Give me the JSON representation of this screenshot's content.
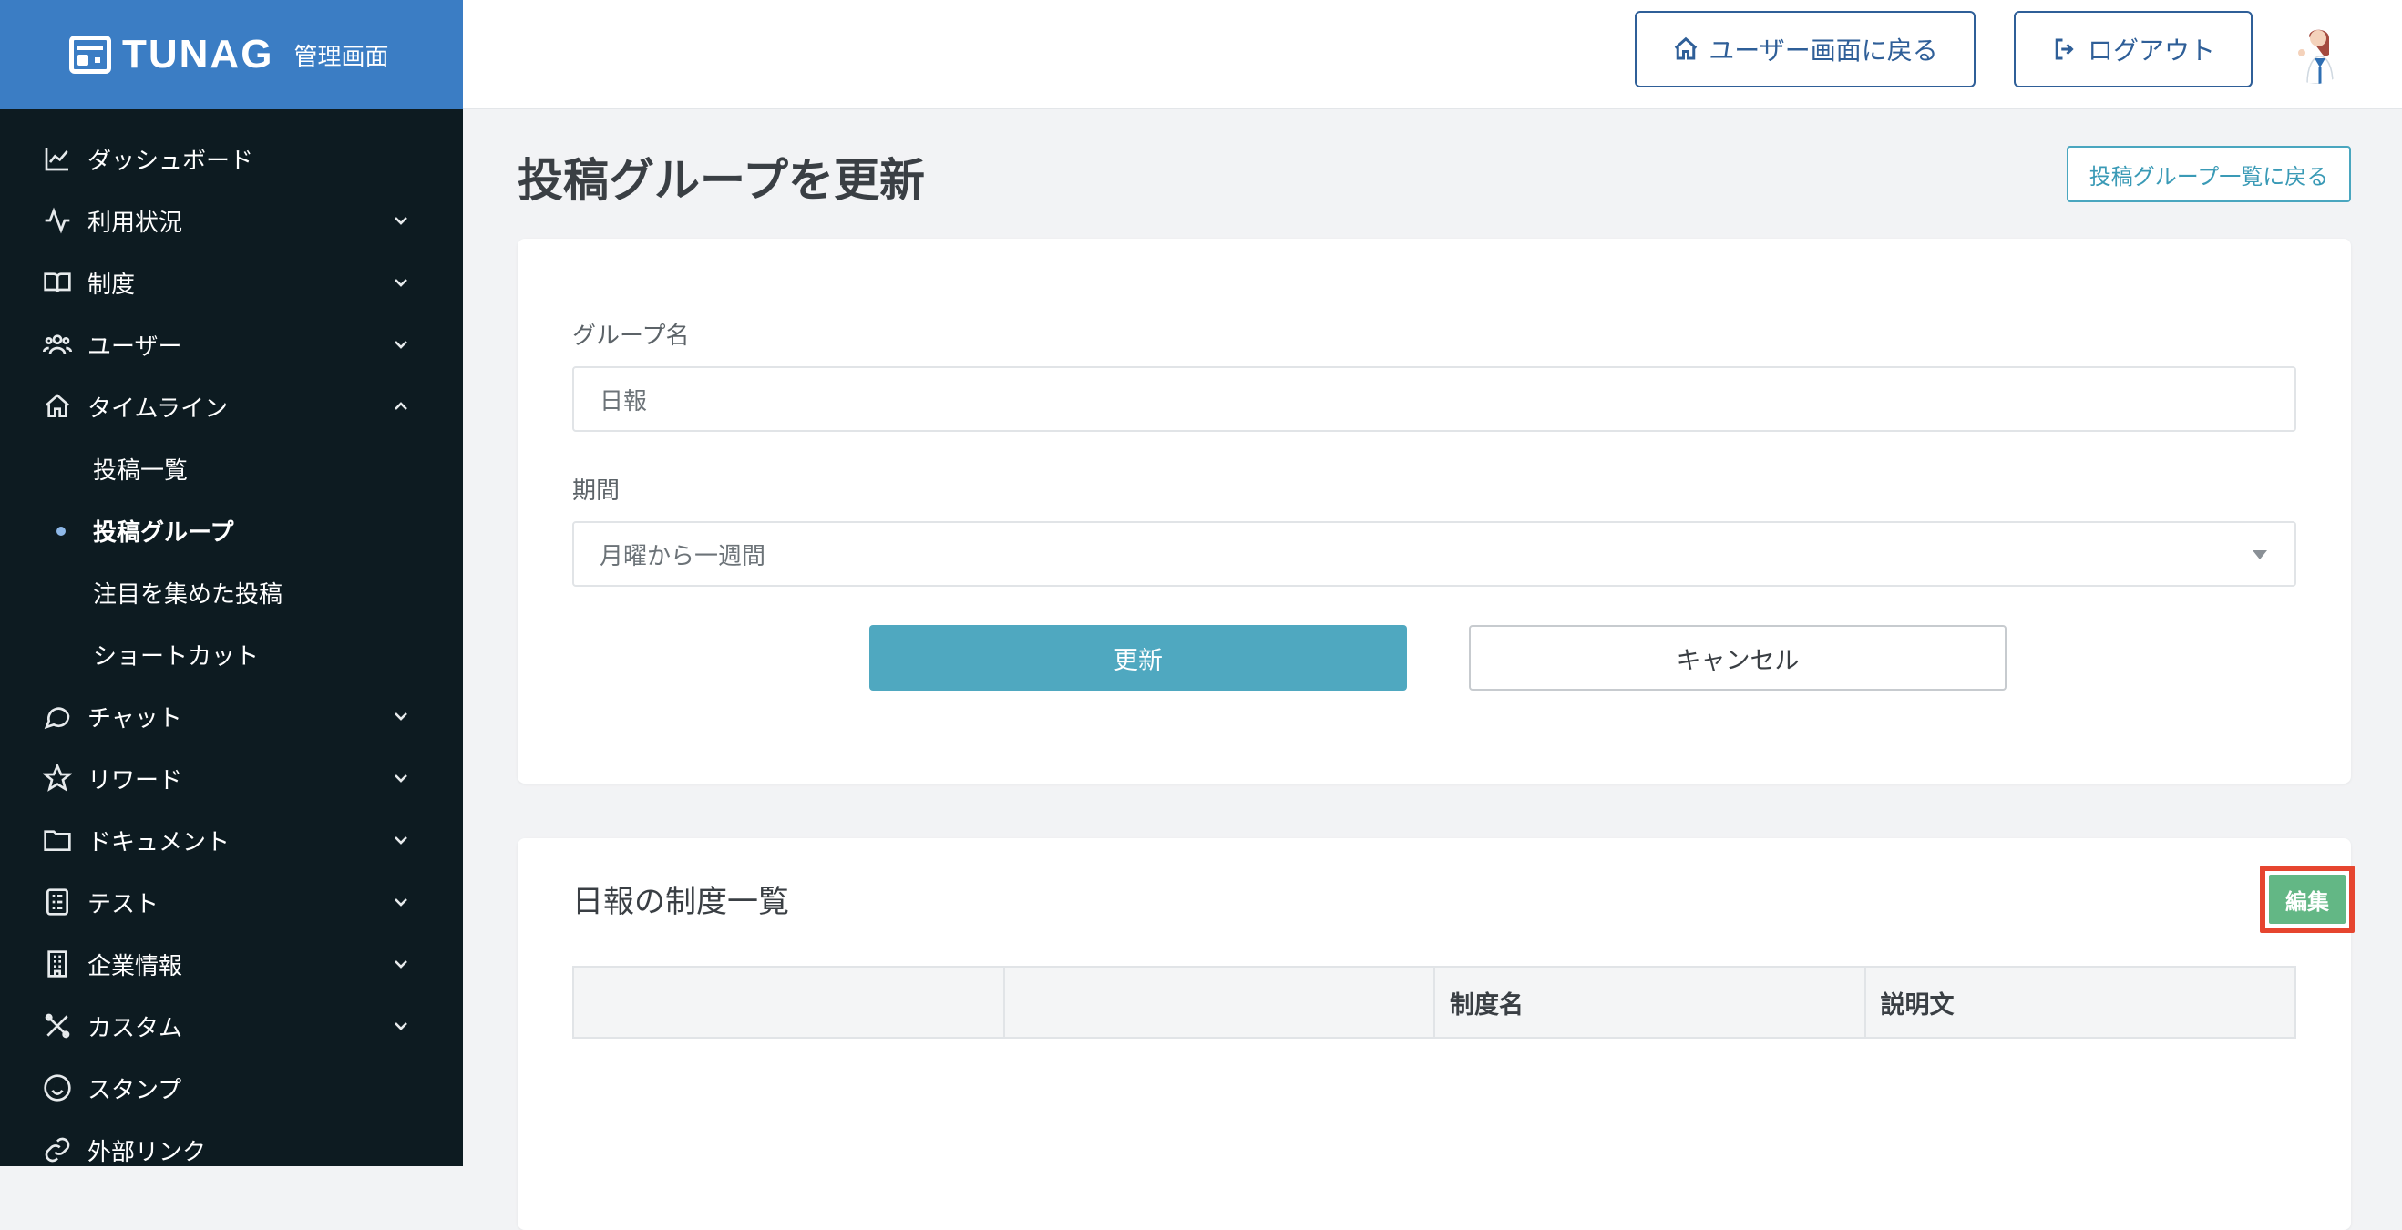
{
  "brand": {
    "name": "TUNAG",
    "subtitle": "管理画面"
  },
  "sidebar": {
    "items": [
      {
        "label": "ダッシュボード",
        "icon": "chart-line-icon",
        "expandable": false
      },
      {
        "label": "利用状況",
        "icon": "activity-icon",
        "expandable": true
      },
      {
        "label": "制度",
        "icon": "book-icon",
        "expandable": true
      },
      {
        "label": "ユーザー",
        "icon": "users-icon",
        "expandable": true
      },
      {
        "label": "タイムライン",
        "icon": "home-icon",
        "expandable": true,
        "expanded": true,
        "children": [
          {
            "label": "投稿一覧"
          },
          {
            "label": "投稿グループ",
            "active": true
          },
          {
            "label": "注目を集めた投稿"
          },
          {
            "label": "ショートカット"
          }
        ]
      },
      {
        "label": "チャット",
        "icon": "chat-bubble-icon",
        "expandable": true
      },
      {
        "label": "リワード",
        "icon": "star-icon",
        "expandable": true
      },
      {
        "label": "ドキュメント",
        "icon": "folder-icon",
        "expandable": true
      },
      {
        "label": "テスト",
        "icon": "checklist-icon",
        "expandable": true
      },
      {
        "label": "企業情報",
        "icon": "building-icon",
        "expandable": true
      },
      {
        "label": "カスタム",
        "icon": "tools-icon",
        "expandable": true
      },
      {
        "label": "スタンプ",
        "icon": "smile-icon",
        "expandable": false
      },
      {
        "label": "外部リンク",
        "icon": "link-icon",
        "expandable": false
      }
    ]
  },
  "header": {
    "user_button": "ユーザー画面に戻る",
    "logout_button": "ログアウト"
  },
  "page": {
    "title": "投稿グループを更新",
    "back_button": "投稿グループ一覧に戻る"
  },
  "form": {
    "group_name_label": "グループ名",
    "group_name_value": "日報",
    "period_label": "期間",
    "period_value": "月曜から一週間",
    "update_button": "更新",
    "cancel_button": "キャンセル"
  },
  "list": {
    "title": "日報の制度一覧",
    "edit_button": "編集",
    "columns": [
      "",
      "",
      "制度名",
      "説明文"
    ]
  },
  "colors": {
    "brand_blue": "#3b7dc4",
    "sidebar_bg": "#0d1b21",
    "primary_teal": "#4fa8c0",
    "edit_green": "#63b785",
    "highlight_red": "#e6452f"
  }
}
